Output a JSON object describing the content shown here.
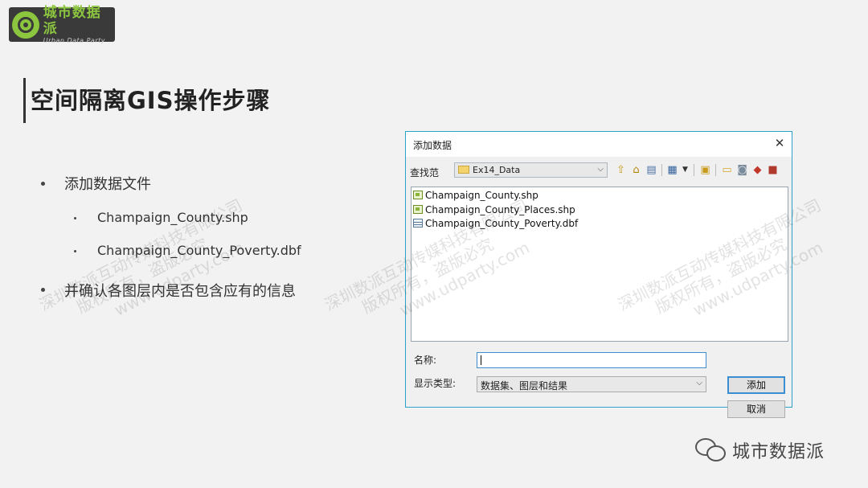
{
  "logo": {
    "name_cn": "城市数据派",
    "name_en": "Urban Data Party"
  },
  "slide": {
    "title": "空间隔离GIS操作步骤",
    "bullets": [
      {
        "text": "添加数据文件",
        "subitems": [
          "Champaign_County.shp",
          "Champaign_County_Poverty.dbf"
        ]
      },
      {
        "text": "并确认各图层内是否包含应有的信息"
      }
    ]
  },
  "watermark": {
    "line1": "深圳数派互动传媒科技有限公司",
    "line2": "版权所有，盗版必究",
    "line3": "www.udparty.com"
  },
  "dialog": {
    "title": "添加数据",
    "close_icon": "close-icon",
    "look_in_label": "查找范",
    "look_in_value": "Ex14_Data",
    "toolbar_icons": [
      "up-folder-icon",
      "home-icon",
      "catalog-icon",
      "view-options-icon",
      "new-folder-icon",
      "connect-folder-icon",
      "database-icon",
      "layer-icon",
      "toolbox-icon"
    ],
    "files": [
      {
        "name": "Champaign_County.shp",
        "icon": "shapefile-icon"
      },
      {
        "name": "Champaign_County_Places.shp",
        "icon": "shapefile-icon"
      },
      {
        "name": "Champaign_County_Poverty.dbf",
        "icon": "table-icon"
      }
    ],
    "name_label": "名称:",
    "name_value": "",
    "type_label": "显示类型:",
    "type_value": "数据集、图层和结果",
    "add_button": "添加",
    "cancel_button": "取消",
    "accent_color": "#29a3c9"
  },
  "footer": {
    "brand": "城市数据派",
    "icon": "wechat-icon"
  }
}
